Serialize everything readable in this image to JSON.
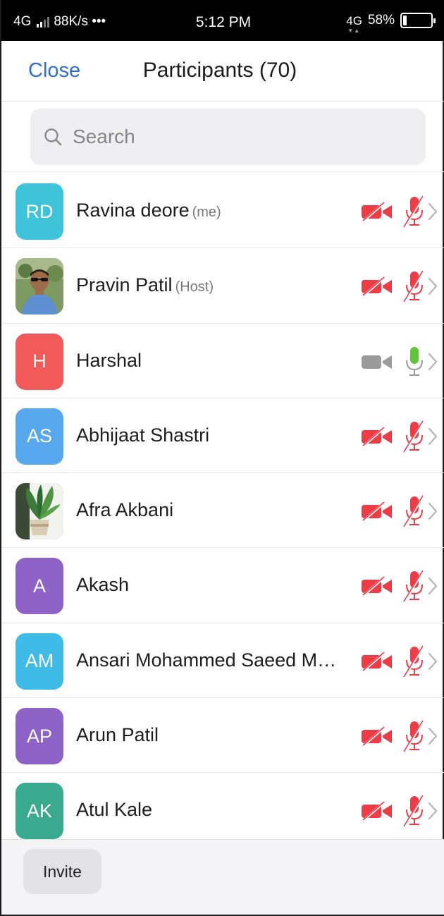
{
  "status_bar": {
    "network": "4G",
    "speed": "88K/s •••",
    "time": "5:12 PM",
    "lte": "4G",
    "battery": "58%",
    "battery_level": 0.58
  },
  "header": {
    "close_label": "Close",
    "title": "Participants (70)"
  },
  "search": {
    "placeholder": "Search",
    "value": ""
  },
  "participants": [
    {
      "initials": "RD",
      "name": "Ravina deore",
      "tag": "(me)",
      "avatar_color": "#3fc3d9",
      "photo": false,
      "video": "off",
      "audio": "muted"
    },
    {
      "initials": "",
      "name": "Pravin Patil",
      "tag": "(Host)",
      "avatar_color": "#6f8f57",
      "photo": "person",
      "video": "off",
      "audio": "muted"
    },
    {
      "initials": "H",
      "name": "Harshal",
      "tag": "",
      "avatar_color": "#f25a5a",
      "photo": false,
      "video": "available",
      "audio": "unmuted"
    },
    {
      "initials": "AS",
      "name": "Abhijaat Shastri",
      "tag": "",
      "avatar_color": "#57a8ef",
      "photo": false,
      "video": "off",
      "audio": "muted"
    },
    {
      "initials": "",
      "name": "Afra Akbani",
      "tag": "",
      "avatar_color": "#4f6b49",
      "photo": "plant",
      "video": "off",
      "audio": "muted"
    },
    {
      "initials": "A",
      "name": "Akash",
      "tag": "",
      "avatar_color": "#8d63c7",
      "photo": false,
      "video": "off",
      "audio": "muted"
    },
    {
      "initials": "AM",
      "name": "Ansari Mohammed Saeed M…",
      "tag": "",
      "avatar_color": "#3fbbe8",
      "photo": false,
      "video": "off",
      "audio": "muted"
    },
    {
      "initials": "AP",
      "name": "Arun Patil",
      "tag": "",
      "avatar_color": "#8d63c7",
      "photo": false,
      "video": "off",
      "audio": "muted"
    },
    {
      "initials": "AK",
      "name": "Atul Kale",
      "tag": "",
      "avatar_color": "#3aaa8e",
      "photo": false,
      "video": "off",
      "audio": "muted"
    }
  ],
  "footer": {
    "invite_label": "Invite"
  },
  "colors": {
    "accent": "#2d6fd2",
    "muted_red": "#ef3b46",
    "unmuted_green": "#5fc43a",
    "cam_gray": "#9b9b9b",
    "chevron": "#b5b5b5"
  },
  "icons": {
    "video_off": "video-off-icon",
    "video_on": "video-icon",
    "mic_muted": "mic-muted-icon",
    "mic_on": "mic-icon",
    "chevron": "chevron-right-icon",
    "search": "search-icon"
  }
}
